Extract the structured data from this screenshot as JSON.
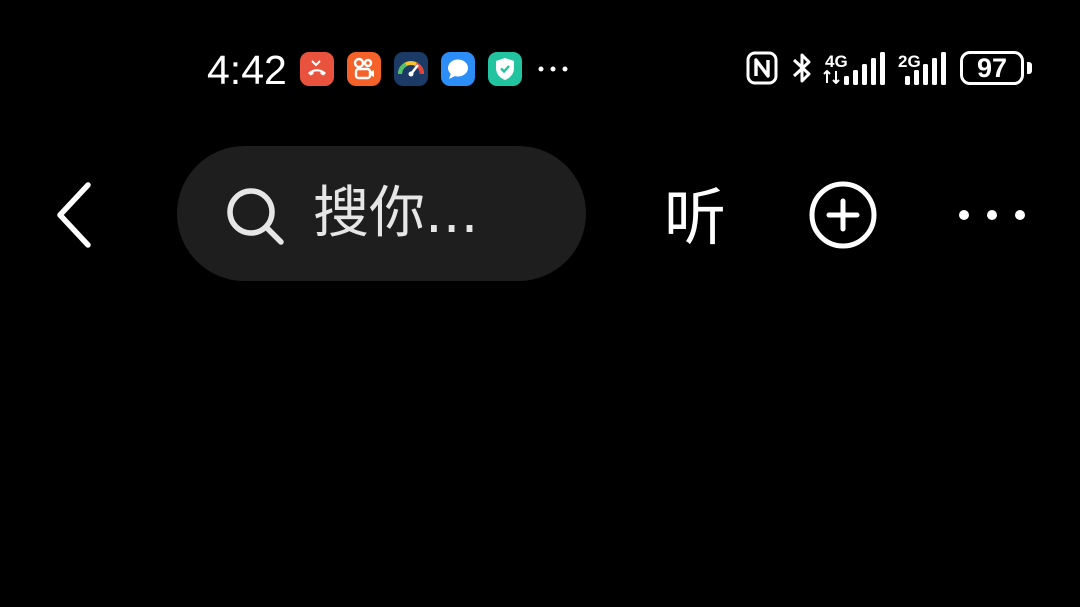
{
  "status_bar": {
    "time": "4:42",
    "notification_icons": [
      {
        "name": "missed-call-icon",
        "color": "#e9533e"
      },
      {
        "name": "kuaishou-icon",
        "color": "#f4622a"
      },
      {
        "name": "speedometer-icon",
        "color": "#1b3a66"
      },
      {
        "name": "message-bubble-icon",
        "color": "#2b8df5"
      },
      {
        "name": "security-shield-icon",
        "color": "#22c4a0"
      }
    ],
    "network_1": "4G",
    "network_2": "2G",
    "battery_level": "97"
  },
  "toolbar": {
    "search_placeholder": "搜你...",
    "listen_label": "听"
  },
  "colors": {
    "background": "#000000",
    "search_box": "#1e1e1e",
    "text": "#ffffff"
  }
}
